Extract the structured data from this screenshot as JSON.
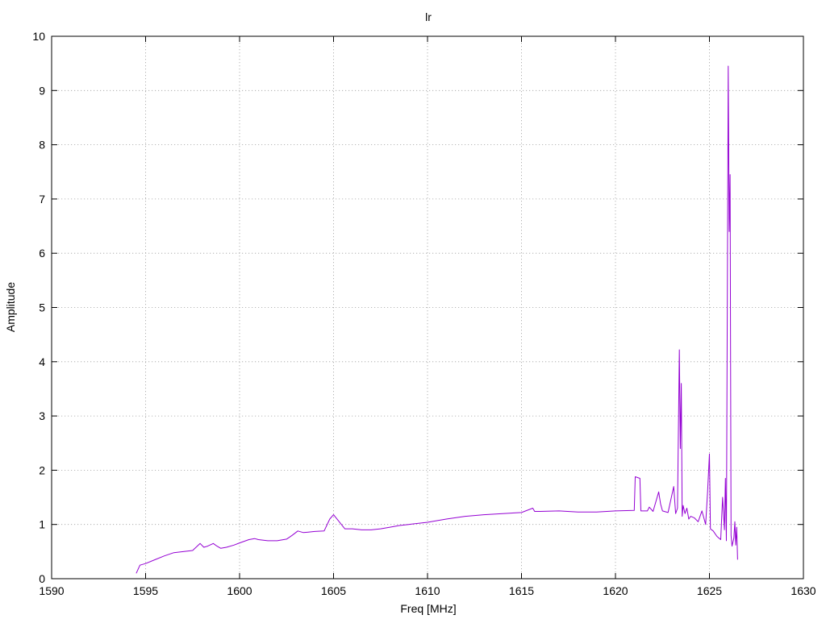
{
  "chart_data": {
    "type": "line",
    "title": "lr",
    "xlabel": "Freq [MHz]",
    "ylabel": "Amplitude",
    "xlim": [
      1590,
      1630
    ],
    "ylim": [
      0,
      10
    ],
    "xticks": [
      1590,
      1595,
      1600,
      1605,
      1610,
      1615,
      1620,
      1625,
      1630
    ],
    "yticks": [
      0,
      1,
      2,
      3,
      4,
      5,
      6,
      7,
      8,
      9,
      10
    ],
    "grid": true,
    "legend": "none",
    "color": "#9400d3",
    "series": [
      {
        "x": [
          1594.5,
          1594.7,
          1595.0,
          1595.5,
          1596.0,
          1596.5,
          1597.0,
          1597.5,
          1597.9,
          1598.1,
          1598.3,
          1598.6,
          1598.8,
          1599.0,
          1599.3,
          1599.7,
          1600.0,
          1600.5,
          1600.8,
          1601.0,
          1601.5,
          1602.0,
          1602.5,
          1602.8,
          1603.1,
          1603.4,
          1603.7,
          1604.0,
          1604.5,
          1604.8,
          1605.0,
          1605.3,
          1605.6,
          1606.0,
          1606.5,
          1607.0,
          1607.5,
          1608.0,
          1608.5,
          1609.0,
          1610.0,
          1611.0,
          1612.0,
          1613.0,
          1614.0,
          1615.0,
          1615.6,
          1615.7,
          1616.0,
          1617.0,
          1618.0,
          1619.0,
          1620.0,
          1621.0,
          1621.05,
          1621.3,
          1621.35,
          1621.7,
          1621.8,
          1622.0,
          1622.3,
          1622.4,
          1622.5,
          1622.8,
          1623.1,
          1623.2,
          1623.3,
          1623.4,
          1623.45,
          1623.5,
          1623.55,
          1623.6,
          1623.7,
          1623.8,
          1623.9,
          1624.0,
          1624.2,
          1624.4,
          1624.6,
          1624.8,
          1624.9,
          1625.0,
          1625.05,
          1625.2,
          1625.4,
          1625.6,
          1625.7,
          1625.8,
          1625.85,
          1625.9,
          1626.0,
          1626.05,
          1626.1,
          1626.15,
          1626.2,
          1626.3,
          1626.35,
          1626.4,
          1626.45,
          1626.5
        ],
        "y": [
          0.1,
          0.25,
          0.28,
          0.35,
          0.42,
          0.48,
          0.5,
          0.52,
          0.65,
          0.58,
          0.6,
          0.65,
          0.6,
          0.56,
          0.58,
          0.62,
          0.66,
          0.72,
          0.74,
          0.72,
          0.7,
          0.7,
          0.73,
          0.8,
          0.88,
          0.85,
          0.86,
          0.87,
          0.88,
          1.1,
          1.18,
          1.05,
          0.92,
          0.92,
          0.9,
          0.9,
          0.92,
          0.95,
          0.98,
          1.0,
          1.04,
          1.1,
          1.15,
          1.18,
          1.2,
          1.22,
          1.3,
          1.24,
          1.24,
          1.25,
          1.23,
          1.23,
          1.25,
          1.26,
          1.88,
          1.85,
          1.25,
          1.25,
          1.32,
          1.24,
          1.6,
          1.38,
          1.25,
          1.22,
          1.7,
          1.2,
          1.3,
          4.22,
          2.4,
          3.6,
          1.15,
          1.35,
          1.2,
          1.3,
          1.1,
          1.15,
          1.12,
          1.05,
          1.25,
          1.0,
          1.6,
          2.3,
          0.92,
          0.88,
          0.78,
          0.72,
          1.5,
          0.9,
          1.85,
          0.7,
          9.45,
          6.4,
          7.45,
          0.8,
          0.6,
          0.75,
          1.05,
          0.62,
          0.95,
          0.35
        ]
      }
    ]
  }
}
